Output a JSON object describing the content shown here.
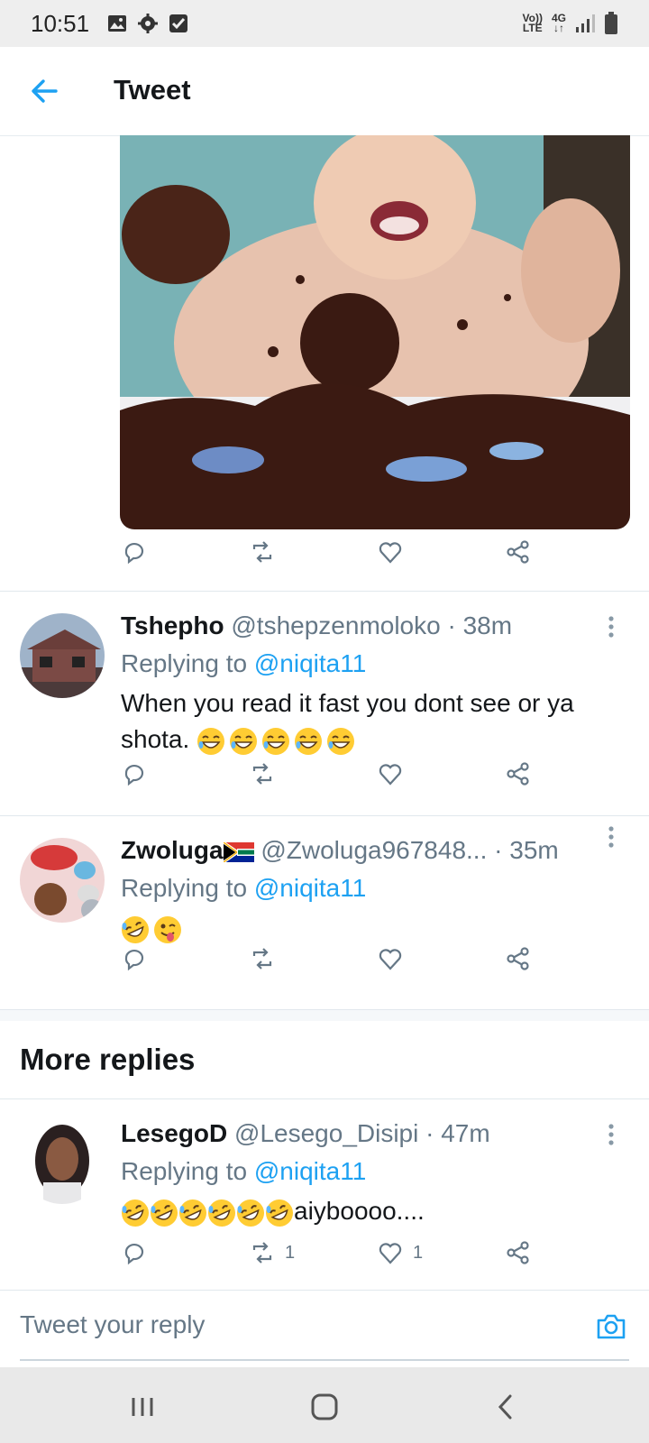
{
  "status_bar": {
    "time": "10:51",
    "network_top": "Vo))",
    "network_bottom": "LTE",
    "signal_type": "4G",
    "icons": [
      "gallery-icon",
      "settings-gear-icon",
      "checkbox-icon",
      "volte-icon",
      "signal-icon",
      "battery-icon"
    ]
  },
  "header": {
    "title": "Tweet",
    "back_icon": "arrow-left-icon"
  },
  "photo": {
    "icon": "baby-cake-photo"
  },
  "main_actions": {
    "reply_icon": "reply-icon",
    "retweet_icon": "retweet-icon",
    "like_icon": "heart-icon",
    "share_icon": "share-icon"
  },
  "replies": [
    {
      "name": "Tshepho",
      "handle": "@tshepzenmoloko · 38m",
      "replying_label": "Replying to",
      "replying_to": "@niqita11",
      "text": "When you read it fast you dont see or ya shota.",
      "emojis": [
        "grin-sweat",
        "grin-sweat",
        "grin-sweat",
        "grin-sweat",
        "grin-sweat"
      ]
    },
    {
      "name": "Zwoluga",
      "handle": "@Zwoluga967848...",
      "time": "· 35m",
      "replying_label": "Replying to",
      "replying_to": "@niqita11",
      "text": "",
      "emojis": [
        "rofl",
        "tongue-wink"
      ]
    }
  ],
  "more_replies": {
    "heading": "More replies",
    "items": [
      {
        "name": "LesegoD",
        "handle": "@Lesego_Disipi · 47m",
        "replying_label": "Replying to",
        "replying_to": "@niqita11",
        "text": "aiyboooo....",
        "emojis": [
          "rofl",
          "rofl",
          "rofl",
          "rofl",
          "rofl",
          "rofl"
        ],
        "retweet_count": "1",
        "like_count": "1"
      }
    ]
  },
  "compose": {
    "placeholder": "Tweet your reply",
    "camera_icon": "camera-icon"
  },
  "navbar": {
    "icons": [
      "recent-apps-icon",
      "home-icon",
      "back-icon"
    ]
  },
  "colors": {
    "accent": "#1da1f2",
    "secondary_text": "#657786",
    "primary_text": "#14171a"
  }
}
